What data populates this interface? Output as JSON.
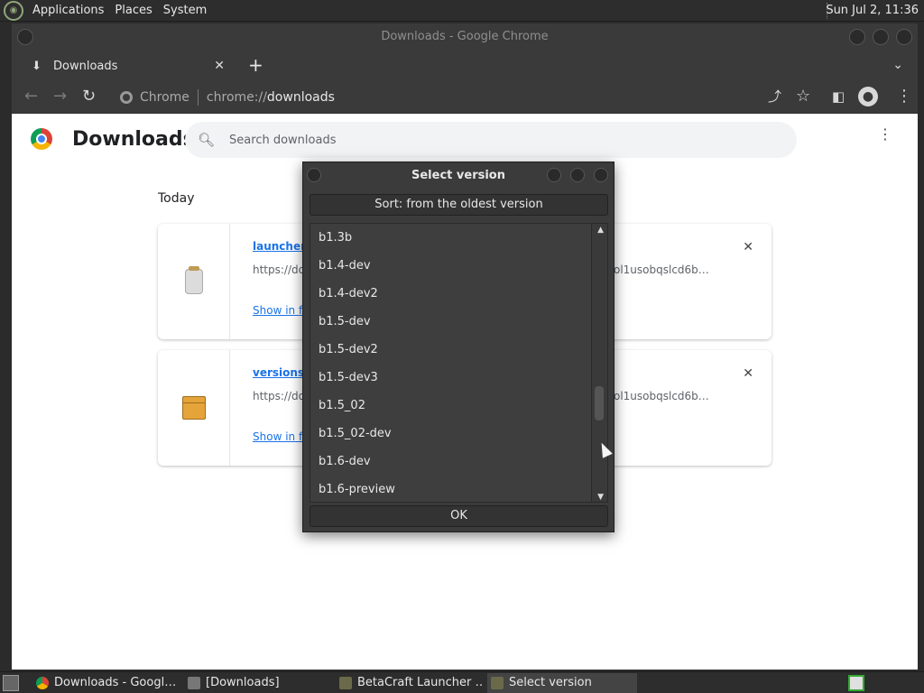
{
  "top_panel": {
    "menus": [
      "Applications",
      "Places",
      "System"
    ],
    "clock": "Sun Jul 2, 11:36"
  },
  "chrome": {
    "window_title": "Downloads - Google Chrome",
    "tab_title": "Downloads",
    "omnibox": {
      "site_label": "Chrome",
      "url_scheme": "chrome://",
      "url_host": "downloads"
    }
  },
  "downloads_page": {
    "title": "Downloads",
    "search_placeholder": "Search downloads",
    "section_date": "Today",
    "items": [
      {
        "name": "launcher-",
        "url_start": "https://do",
        "url_end": "ol1usobqslcd6b…",
        "action": "Show in fo"
      },
      {
        "name": "versions.",
        "url_start": "https://do",
        "url_end": "ol1usobqslcd6b…",
        "action": "Show in fo"
      }
    ]
  },
  "dialog": {
    "title": "Select version",
    "sort_label": "Sort: from the oldest version",
    "versions": [
      "b1.3b",
      "b1.4-dev",
      "b1.4-dev2",
      "b1.5-dev",
      "b1.5-dev2",
      "b1.5-dev3",
      "b1.5_02",
      "b1.5_02-dev",
      "b1.6-dev",
      "b1.6-preview"
    ],
    "ok_label": "OK"
  },
  "taskbar": {
    "tasks": [
      "Downloads - Googl…",
      "[Downloads]",
      "BetaCraft Launcher …",
      "Select version"
    ]
  }
}
